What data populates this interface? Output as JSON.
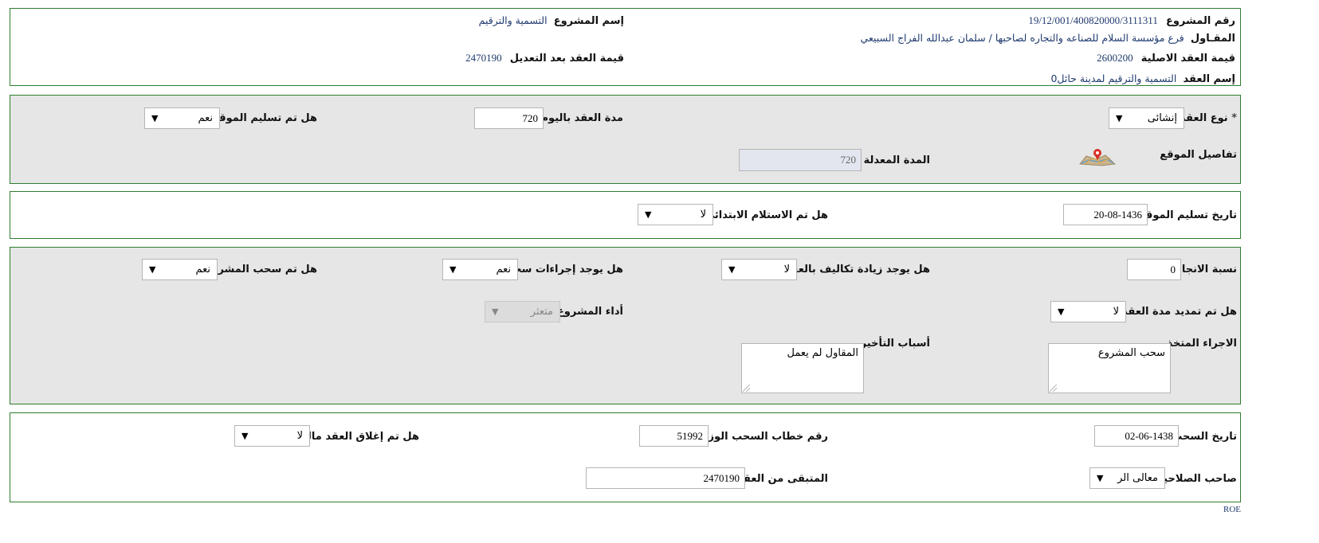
{
  "header": {
    "project_number_label": "رقم المشروع",
    "project_number": "19/12/001/400820000/3111311",
    "contractor_label": "المقـاول",
    "contractor": "فرع مؤسسة السلام للصناعه والتجاره لصاحبها / سلمان عبدالله الفراج السبيعي",
    "original_value_label": "قيمة العقد الاصلية",
    "original_value": "2600200",
    "contract_name_label": "إسم العقد",
    "contract_name": "التسمية والترقيم لمدينة حائل0",
    "project_name_label": "إسم المشروع",
    "project_name": "التسمية والترقيم",
    "value_after_label": "قيمة العقد بعد التعديل",
    "value_after": "2470190"
  },
  "contract": {
    "type_label": "نوع العقد",
    "required_mark": "*",
    "type_value": "إنشائى",
    "duration_label": "مدة العقد باليوم",
    "duration_value": "720",
    "site_delivered_label": "هل تم تسليم الموقع",
    "site_delivered_value": "نعم",
    "site_details_label": "تفاصيل الموقع",
    "modified_duration_label": "المدة المعدلة",
    "modified_duration_value": "720"
  },
  "delivery": {
    "date_label": "تاريخ تسليم الموقع",
    "date_value": "20-08-1436",
    "initial_receipt_label": "هل تم الاستلام الابتدائى",
    "initial_receipt_value": "لا"
  },
  "progress": {
    "completion_label": "نسبة الانجاز",
    "completion_value": "0",
    "cost_increase_label": "هل يوجد زيادة تكاليف بالعقد",
    "cost_increase_value": "لا",
    "withdraw_procedures_label": "هل يوجد إجراءات سحب",
    "withdraw_procedures_value": "نعم",
    "withdrawn_label": "هل تم سحب المشروع",
    "withdrawn_value": "نعم",
    "extended_label": "هل تم تمديد مدة العقد",
    "extended_value": "لا",
    "performance_label": "أداء المشروع",
    "performance_value": "متعثر",
    "action_label": "الاجراء المتخذ",
    "action_value": "سحب المشروع",
    "delay_reasons_label": "أسباب التأخير",
    "delay_reasons_value": "المقاول لم يعمل"
  },
  "withdrawal": {
    "date_label": "تاريخ السحب",
    "date_value": "02-06-1438",
    "letter_number_label": "رقم خطاب السحب الوزارى",
    "letter_number_value": "51992",
    "financial_close_label": "هل تم إغلاق العقد ماليا",
    "financial_close_value": "لا",
    "authority_label": "صاحب الصلاحية",
    "authority_value": "معالى الر",
    "remaining_label": "المتبقى من العقد",
    "remaining_value": "2470190"
  },
  "footer": {
    "code": "ROE"
  },
  "icons": {
    "arrow": "▼",
    "map": "map-pin-icon"
  },
  "colors": {
    "border": "#2e7d2e",
    "value_text": "#1f3a6e",
    "grey_panel": "#e6e6e6"
  }
}
